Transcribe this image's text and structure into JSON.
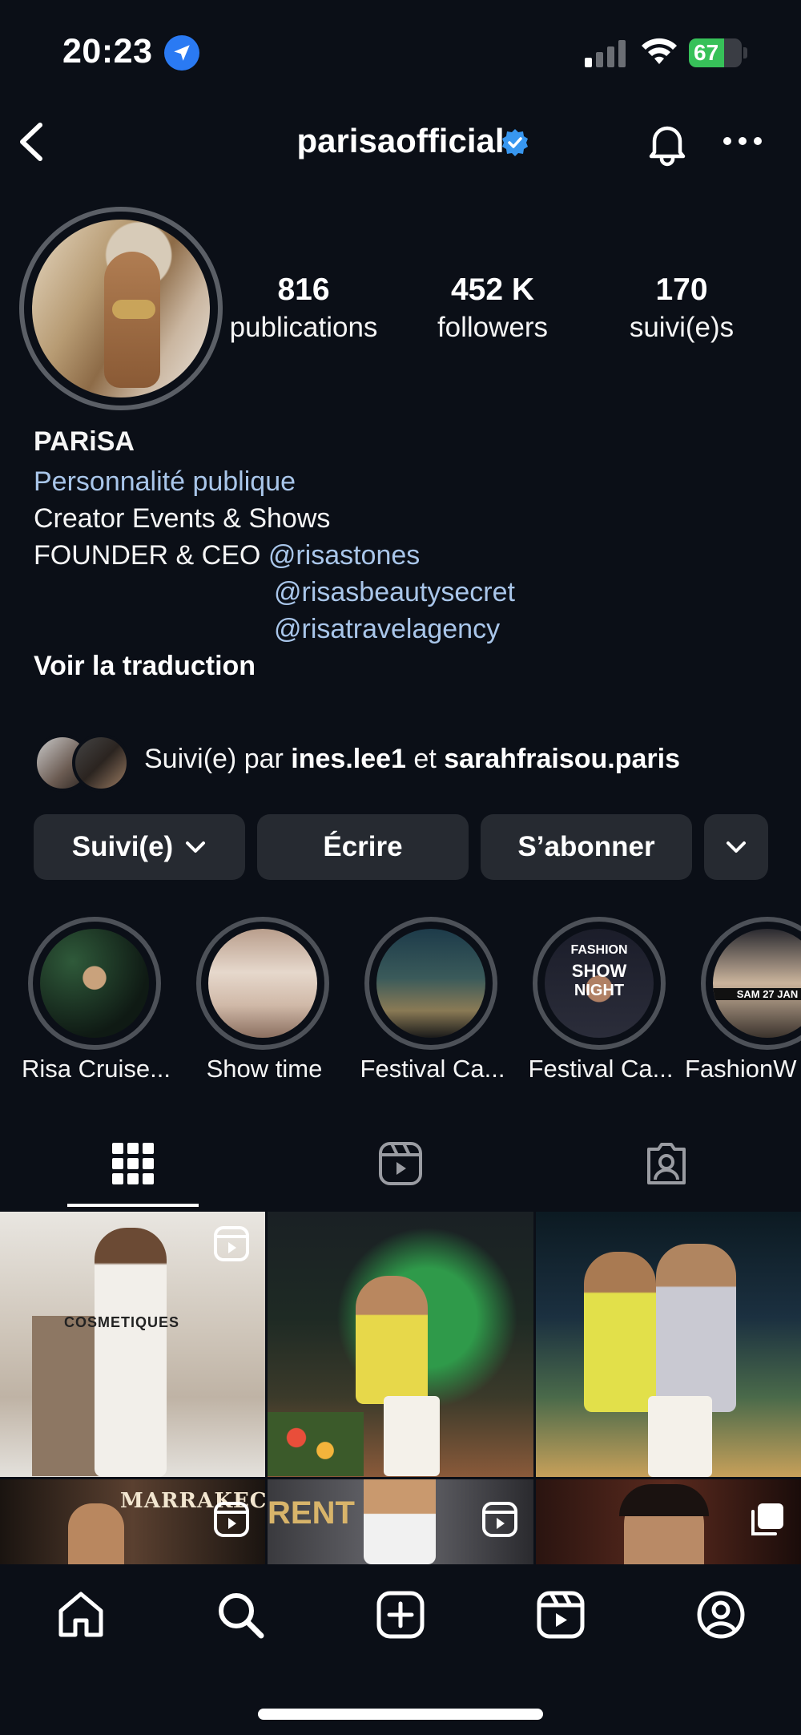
{
  "status_bar": {
    "time": "20:23",
    "battery": "67",
    "battery_level": 0.67
  },
  "header": {
    "username": "parisaofficial"
  },
  "stats": [
    {
      "value": "816",
      "label": "publications"
    },
    {
      "value": "452 K",
      "label": "followers"
    },
    {
      "value": "170",
      "label": "suivi(e)s"
    }
  ],
  "bio": {
    "name": "PARiSA",
    "category": "Personnalité publique",
    "line1": "Creator Events & Shows",
    "line2_prefix": "FOUNDER & CEO",
    "mentions": [
      "@risastones",
      "@risasbeautysecret",
      "@risatravelagency"
    ],
    "translate": "Voir la traduction"
  },
  "followed_by": {
    "prefix": "Suivi(e) par",
    "user1": "ines.lee1",
    "connector": "et",
    "user2": "sarahfraisou.paris"
  },
  "actions": {
    "follow": "Suivi(e)",
    "message": "Écrire",
    "subscribe": "S’abonner"
  },
  "highlights": [
    {
      "label": "Risa Cruise..."
    },
    {
      "label": "Show time"
    },
    {
      "label": "Festival Ca..."
    },
    {
      "label": "Festival Ca..."
    },
    {
      "label": "FashionW"
    }
  ],
  "highlight_art": {
    "fashion": "FASHION",
    "show": "SHOW",
    "night": "NIGHT",
    "date": "SAM 27 JAN"
  },
  "grid_tiles": {
    "tile1_text": "COSMETIQUES",
    "tile4_text": "MARRAKECH",
    "tile5_text": "RENT"
  },
  "colors": {
    "background": "#0b0f17",
    "button": "#262a31",
    "link": "#a9c6ea",
    "verified": "#3897f0",
    "battery_green": "#37c159"
  }
}
